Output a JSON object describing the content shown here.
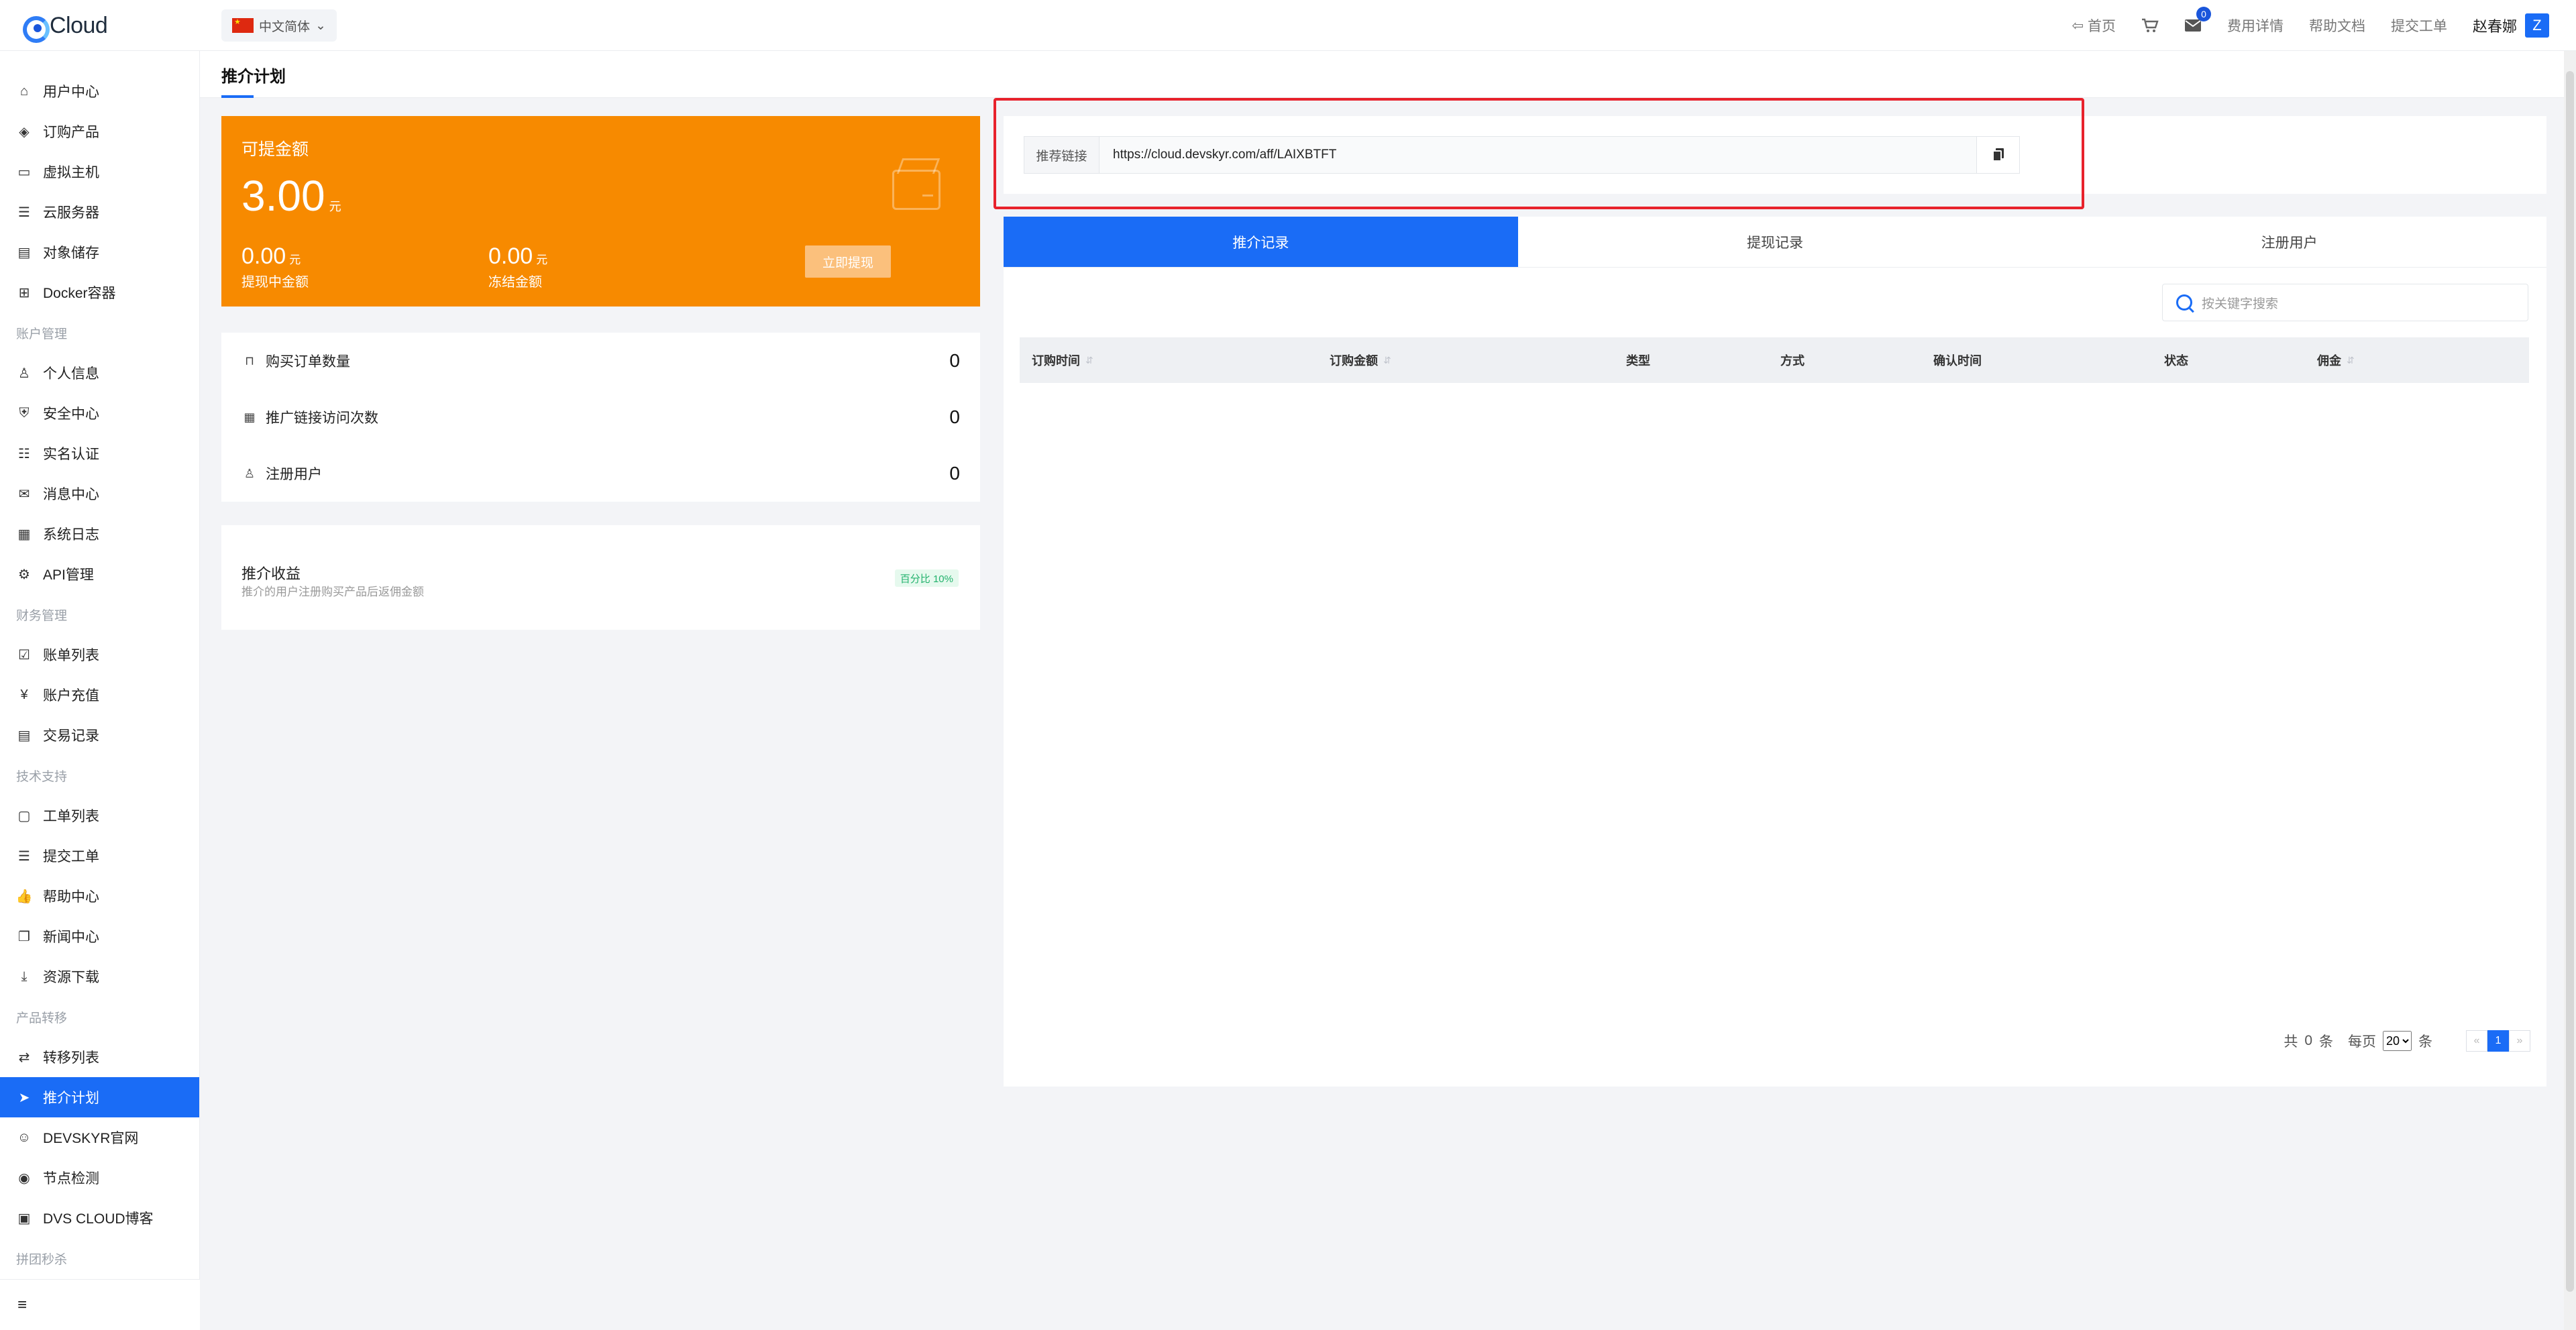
{
  "header": {
    "brand": "Cloud",
    "language": "中文简体",
    "nav": {
      "home": "首页",
      "message_count": "0",
      "fees": "费用详情",
      "docs": "帮助文档",
      "ticket": "提交工单"
    },
    "user": {
      "name": "赵春娜",
      "initial": "Z"
    }
  },
  "sidebar": {
    "items": [
      {
        "label": "用户中心",
        "icon": "home-icon"
      },
      {
        "label": "订购产品",
        "icon": "cube-icon"
      },
      {
        "label": "虚拟主机",
        "icon": "drive-icon"
      },
      {
        "label": "云服务器",
        "icon": "server-icon"
      },
      {
        "label": "对象储存",
        "icon": "folder-icon"
      },
      {
        "label": "Docker容器",
        "icon": "grid-icon"
      }
    ],
    "group_account": "账户管理",
    "account_items": [
      {
        "label": "个人信息",
        "icon": "user-icon"
      },
      {
        "label": "安全中心",
        "icon": "shield-icon"
      },
      {
        "label": "实名认证",
        "icon": "id-card-icon"
      },
      {
        "label": "消息中心",
        "icon": "mail-icon"
      },
      {
        "label": "系统日志",
        "icon": "file-icon"
      },
      {
        "label": "API管理",
        "icon": "gear-icon"
      }
    ],
    "group_finance": "财务管理",
    "finance_items": [
      {
        "label": "账单列表",
        "icon": "checklist-icon"
      },
      {
        "label": "账户充值",
        "icon": "yen-icon"
      },
      {
        "label": "交易记录",
        "icon": "receipt-icon"
      }
    ],
    "group_support": "技术支持",
    "support_items": [
      {
        "label": "工单列表",
        "icon": "chat-icon"
      },
      {
        "label": "提交工单",
        "icon": "form-icon"
      },
      {
        "label": "帮助中心",
        "icon": "thumbs-up-icon"
      },
      {
        "label": "新闻中心",
        "icon": "news-icon"
      },
      {
        "label": "资源下载",
        "icon": "download-icon"
      }
    ],
    "group_transfer": "产品转移",
    "transfer_items": [
      {
        "label": "转移列表",
        "icon": "transfer-icon"
      },
      {
        "label": "推介计划",
        "icon": "send-icon",
        "active": true
      },
      {
        "label": "DEVSKYR官网",
        "icon": "smile-icon"
      },
      {
        "label": "节点检测",
        "icon": "radar-icon"
      },
      {
        "label": "DVS CLOUD博客",
        "icon": "blog-icon"
      }
    ],
    "group_promo": "拼团秒杀"
  },
  "page": {
    "title": "推介计划"
  },
  "balance": {
    "label": "可提金额",
    "amount": "3.00",
    "unit": "元",
    "pending_amount": "0.00",
    "pending_label": "提现中金额",
    "frozen_amount": "0.00",
    "frozen_label": "冻结金额",
    "withdraw_button": "立即提现"
  },
  "stats": [
    {
      "label": "购买订单数量",
      "value": "0",
      "icon": "bag-icon"
    },
    {
      "label": "推广链接访问次数",
      "value": "0",
      "icon": "calendar-icon"
    },
    {
      "label": "注册用户",
      "value": "0",
      "icon": "user-icon"
    }
  ],
  "earnings": {
    "title": "推介收益",
    "desc": "推介的用户注册购买产品后返佣金额",
    "tag": "百分比 10%"
  },
  "referral_link": {
    "label": "推荐链接",
    "url": "https://cloud.devskyr.com/aff/LAIXBTFT"
  },
  "tabs": [
    "推介记录",
    "提现记录",
    "注册用户"
  ],
  "search": {
    "placeholder": "按关键字搜索"
  },
  "table": {
    "columns": [
      "订购时间",
      "订购金额",
      "类型",
      "方式",
      "确认时间",
      "状态",
      "佣金"
    ]
  },
  "pagination": {
    "total_prefix": "共",
    "total": "0",
    "total_suffix": "条",
    "per_page_label": "每页",
    "per_page": "20",
    "per_page_suffix": "条",
    "current_page": "1"
  },
  "colors": {
    "accent": "#1a6cf6",
    "balance_bg": "#f78a00",
    "highlight_box": "#e8222c"
  }
}
